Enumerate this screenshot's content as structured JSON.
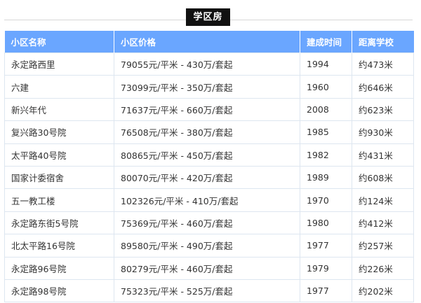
{
  "title": "学区房",
  "table": {
    "headers": [
      "小区名称",
      "小区价格",
      "建成时间",
      "距离学校"
    ],
    "rows": [
      [
        "永定路西里",
        "79055元/平米 - 430万/套起",
        "1994",
        "约473米"
      ],
      [
        "六建",
        "73099元/平米 - 350万/套起",
        "1960",
        "约646米"
      ],
      [
        "新兴年代",
        "71637元/平米 - 660万/套起",
        "2008",
        "约623米"
      ],
      [
        "复兴路30号院",
        "76508元/平米 - 380万/套起",
        "1985",
        "约930米"
      ],
      [
        "太平路40号院",
        "80865元/平米 - 450万/套起",
        "1982",
        "约431米"
      ],
      [
        "国家计委宿舍",
        "80070元/平米 - 420万/套起",
        "1989",
        "约608米"
      ],
      [
        "五一教工楼",
        "102326元/平米 - 410万/套起",
        "1970",
        "约124米"
      ],
      [
        "永定路东街5号院",
        "75369元/平米 - 460万/套起",
        "1980",
        "约412米"
      ],
      [
        "北太平路16号院",
        "89580元/平米 - 490万/套起",
        "1977",
        "约257米"
      ],
      [
        "永定路96号院",
        "80279元/平米 - 460万/套起",
        "1979",
        "约226米"
      ],
      [
        "永定路98号院",
        "75323元/平米 - 525万/套起",
        "1977",
        "约202米"
      ]
    ]
  }
}
